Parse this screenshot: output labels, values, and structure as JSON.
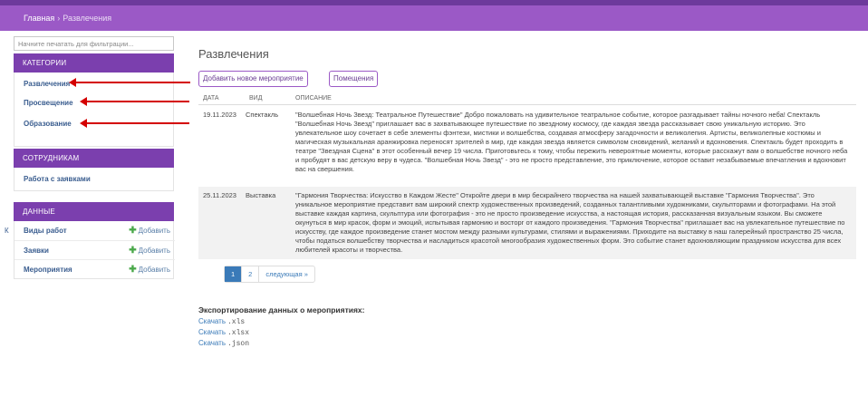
{
  "breadcrumb": {
    "home": "Главная",
    "separator": "›",
    "current": "Развлечения"
  },
  "sidebar": {
    "filter_placeholder": "Начните печатать для фильтрации...",
    "categories": {
      "title": "КАТЕГОРИИ",
      "items": [
        {
          "label": "Развлечения"
        },
        {
          "label": "Просвещение"
        },
        {
          "label": "Образование"
        }
      ]
    },
    "staff": {
      "title": "СОТРУДНИКАМ",
      "items": [
        {
          "label": "Работа с заявками"
        }
      ]
    },
    "data": {
      "title": "ДАННЫЕ",
      "add_label": "Добавить",
      "items": [
        {
          "label": "Виды работ"
        },
        {
          "label": "Заявки"
        },
        {
          "label": "Мероприятия"
        }
      ]
    }
  },
  "left_edge_mark": "К",
  "main": {
    "title": "Развлечения",
    "buttons": {
      "add_event": "Добавить новое мероприятие",
      "rooms": "Помещения"
    },
    "table": {
      "headers": {
        "date": "ДАТА",
        "kind": "ВИД",
        "description": "ОПИСАНИЕ"
      },
      "rows": [
        {
          "date": "19.11.2023",
          "kind": "Спектакль",
          "description": "\"Волшебная Ночь Звезд: Театральное Путешествие\" Добро пожаловать на удивительное театральное событие, которое разгадывает тайны ночного неба! Спектакль \"Волшебная Ночь Звезд\" приглашает вас в захватывающее путешествие по звездному космосу, где каждая звезда рассказывает свою уникальную историю. Это увлекательное шоу сочетает в себе элементы фэнтези, мистики и волшебства, создавая атмосферу загадочности и великолепия. Артисты, великолепные костюмы и магическая музыкальная аранжировка переносят зрителей в мир, где каждая звезда является символом сновидений, желаний и вдохновения. Спектакль будет проходить в театре \"Звездная Сцена\" в этот особенный вечер 19 числа. Приготовьтесь к тому, чтобы пережить невероятные моменты, которые расскажут вам о волшебстве ночного неба и пробудят в вас детскую веру в чудеса. \"Волшебная Ночь Звезд\" - это не просто представление, это приключение, которое оставит незабываемые впечатления и вдохновит вас на свершения."
        },
        {
          "date": "25.11.2023",
          "kind": "Выставка",
          "description": "\"Гармония Творчества: Искусство в Каждом Жесте\" Откройте двери в мир бескрайнего творчества на нашей захватывающей выставке \"Гармония Творчества\". Это уникальное мероприятие представит вам широкий спектр художественных произведений, созданных талантливыми художниками, скульпторами и фотографами. На этой выставке каждая картина, скульптура или фотография - это не просто произведение искусства, а настоящая история, рассказанная визуальным языком. Вы сможете окунуться в мир красок, форм и эмоций, испытывая гармонию и восторг от каждого произведения. \"Гармония Творчества\" приглашает вас на увлекательное путешествие по искусству, где каждое произведение станет мостом между разными культурами, стилями и выражениями. Приходите на выставку в наш галерейный пространство 25 числа, чтобы податься волшебству творчества и насладиться красотой многообразия художественных форм. Это событие станет вдохновляющим праздником искусства для всех любителей красоты и творчества."
        }
      ]
    },
    "pagination": {
      "page1": "1",
      "page2": "2",
      "next": "следующая »"
    },
    "export": {
      "title": "Экспортирование данных о мероприятиях:",
      "download_label": "Скачать",
      "formats": [
        ".xls",
        ".xlsx",
        ".json"
      ]
    }
  },
  "colors": {
    "header": "#9b59c6",
    "section_header": "#7b3fae",
    "link": "#3a5d8f",
    "annotation_arrow": "#d40000"
  }
}
